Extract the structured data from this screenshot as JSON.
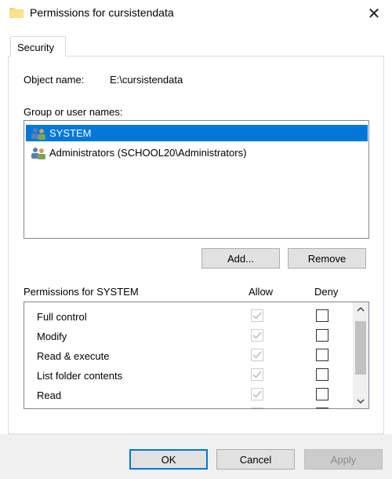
{
  "window": {
    "title": "Permissions for cursistendata",
    "close_glyph": "✕"
  },
  "tabs": [
    {
      "label": "Security"
    }
  ],
  "object": {
    "label": "Object name:",
    "value": "E:\\cursistendata"
  },
  "users": {
    "header": "Group or user names:",
    "items": [
      {
        "label": "SYSTEM",
        "selected": true
      },
      {
        "label": "Administrators (SCHOOL20\\Administrators)",
        "selected": false
      }
    ]
  },
  "user_buttons": {
    "add": "Add...",
    "remove": "Remove"
  },
  "permissions": {
    "header": "Permissions for SYSTEM",
    "allow_label": "Allow",
    "deny_label": "Deny",
    "rows": [
      {
        "name": "Full control",
        "allow": true,
        "deny": false
      },
      {
        "name": "Modify",
        "allow": true,
        "deny": false
      },
      {
        "name": "Read & execute",
        "allow": true,
        "deny": false
      },
      {
        "name": "List folder contents",
        "allow": true,
        "deny": false
      },
      {
        "name": "Read",
        "allow": true,
        "deny": false
      }
    ]
  },
  "dialog_buttons": {
    "ok": "OK",
    "cancel": "Cancel",
    "apply": "Apply"
  },
  "colors": {
    "selection": "#0078d7",
    "check_disabled": "#bcbcbc"
  }
}
